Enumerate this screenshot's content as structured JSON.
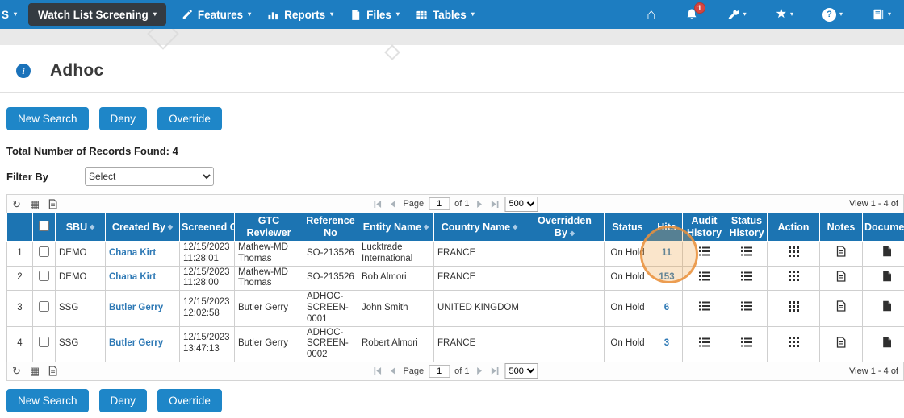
{
  "nav": {
    "region_label": "S",
    "items": [
      {
        "label": "Watch List Screening"
      },
      {
        "label": "Features"
      },
      {
        "label": "Reports"
      },
      {
        "label": "Files"
      },
      {
        "label": "Tables"
      }
    ],
    "notification_count": "1"
  },
  "icons": {
    "caret": "▾",
    "home": "⌂",
    "star": "★",
    "sort": "◆",
    "refresh": "↻",
    "grid_view": "▦",
    "help": "?",
    "info": "i"
  },
  "page": {
    "title": "Adhoc"
  },
  "buttons": {
    "new_search": "New Search",
    "deny": "Deny",
    "override": "Override"
  },
  "summary": {
    "records_found": "Total Number of Records Found: 4"
  },
  "filter": {
    "label": "Filter By",
    "value": "Select"
  },
  "pager": {
    "page_label": "Page",
    "page_value": "1",
    "of_label": "of 1",
    "page_size": "500",
    "view_info": "View 1 - 4 of"
  },
  "table": {
    "headers": {
      "sbu": "SBU",
      "created_by": "Created By",
      "screened_on": "Screened On",
      "gtc_reviewer": "GTC Reviewer",
      "reference_no": "Reference No",
      "entity_name": "Entity Name",
      "country_name": "Country Name",
      "overridden_by": "Overridden By",
      "status": "Status",
      "hits": "Hits",
      "audit_history": "Audit History",
      "status_history": "Status History",
      "action": "Action",
      "notes": "Notes",
      "documents": "Documents"
    },
    "rows": [
      {
        "num": "1",
        "sbu": "DEMO",
        "created_by": "Chana Kirt",
        "screened_on": "12/15/2023 11:28:01",
        "gtc_reviewer": "Mathew-MD Thomas",
        "reference_no": "SO-213526",
        "entity_name": "Lucktrade International",
        "country_name": "FRANCE",
        "overridden_by": "",
        "status": "On Hold",
        "hits": "11"
      },
      {
        "num": "2",
        "sbu": "DEMO",
        "created_by": "Chana Kirt",
        "screened_on": "12/15/2023 11:28:00",
        "gtc_reviewer": "Mathew-MD Thomas",
        "reference_no": "SO-213526",
        "entity_name": "Bob Almori",
        "country_name": "FRANCE",
        "overridden_by": "",
        "status": "On Hold",
        "hits": "153"
      },
      {
        "num": "3",
        "sbu": "SSG",
        "created_by": "Butler Gerry",
        "screened_on": "12/15/2023 12:02:58",
        "gtc_reviewer": "Butler Gerry",
        "reference_no": "ADHOC-SCREEN-0001",
        "entity_name": "John Smith",
        "country_name": "UNITED KINGDOM",
        "overridden_by": "",
        "status": "On Hold",
        "hits": "6"
      },
      {
        "num": "4",
        "sbu": "SSG",
        "created_by": "Butler Gerry",
        "screened_on": "12/15/2023 13:47:13",
        "gtc_reviewer": "Butler Gerry",
        "reference_no": "ADHOC-SCREEN-0002",
        "entity_name": "Robert Almori",
        "country_name": "FRANCE",
        "overridden_by": "",
        "status": "On Hold",
        "hits": "3"
      }
    ]
  },
  "colors": {
    "nav_blue": "#1d7dc1",
    "header_blue": "#1c74b2",
    "button_blue": "#1e86c8",
    "link_blue": "#2e79b5",
    "highlight_orange": "#e9903c",
    "badge_red": "#d64541"
  }
}
